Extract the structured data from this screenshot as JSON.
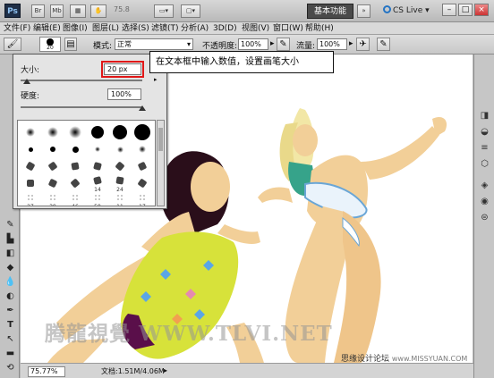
{
  "app": {
    "logo": "Ps",
    "bridge_label": "Br",
    "minibridge_label": "Mb",
    "zoom_readout": "75.8",
    "workspace_label": "基本功能",
    "cslive_label": "CS Live"
  },
  "menu": [
    "文件(F)",
    "编辑(E)",
    "图像(I)",
    "图层(L)",
    "选择(S)",
    "滤镜(T)",
    "分析(A)",
    "3D(D)",
    "视图(V)",
    "窗口(W)",
    "帮助(H)"
  ],
  "options": {
    "brush_size": "20",
    "mode_label": "模式:",
    "mode_value": "正常",
    "opacity_label": "不透明度:",
    "opacity_value": "100%",
    "flow_label": "流量:",
    "flow_value": "100%"
  },
  "brush_picker": {
    "size_label": "大小:",
    "size_value": "20 px",
    "size_slider_fraction": 0.05,
    "hardness_label": "硬度:",
    "hardness_value": "100%",
    "hardness_slider_fraction": 1.0,
    "presets": [
      {
        "kind": "soft",
        "num": ""
      },
      {
        "kind": "soft",
        "num": ""
      },
      {
        "kind": "soft",
        "num": ""
      },
      {
        "kind": "hard",
        "num": ""
      },
      {
        "kind": "hard",
        "num": ""
      },
      {
        "kind": "hard",
        "num": ""
      },
      {
        "kind": "hard-s",
        "num": ""
      },
      {
        "kind": "hard-s",
        "num": ""
      },
      {
        "kind": "hard-s",
        "num": ""
      },
      {
        "kind": "soft-s",
        "num": ""
      },
      {
        "kind": "soft-s",
        "num": ""
      },
      {
        "kind": "soft-s",
        "num": ""
      },
      {
        "kind": "tip",
        "num": ""
      },
      {
        "kind": "tip",
        "num": ""
      },
      {
        "kind": "tip",
        "num": ""
      },
      {
        "kind": "tip",
        "num": ""
      },
      {
        "kind": "tip",
        "num": ""
      },
      {
        "kind": "tip",
        "num": ""
      },
      {
        "kind": "tip",
        "num": ""
      },
      {
        "kind": "tip",
        "num": ""
      },
      {
        "kind": "tip",
        "num": ""
      },
      {
        "kind": "tip",
        "num": "14"
      },
      {
        "kind": "tip",
        "num": "24"
      },
      {
        "kind": "tip",
        "num": ""
      },
      {
        "kind": "scatter",
        "num": "27"
      },
      {
        "kind": "scatter",
        "num": "39"
      },
      {
        "kind": "scatter",
        "num": "46"
      },
      {
        "kind": "scatter",
        "num": "59"
      },
      {
        "kind": "scatter",
        "num": "11"
      },
      {
        "kind": "scatter",
        "num": "17"
      }
    ]
  },
  "callout": "在文本框中输入数值，设置画笔大小",
  "status": {
    "zoom": "75.77%",
    "doc_info": "文档:1.51M/4.06M"
  },
  "watermark": "腾龍視覺 WWW.TLVI.NET",
  "credit_main": "思缘设计论坛",
  "credit_site": "www.MISSYUAN.COM",
  "colors": {
    "workspace_button": "#4a4a4a",
    "callout_border": "#111111",
    "highlight": "#e01818",
    "dress_yellow": "#d7e23a",
    "skin": "#f2cf98"
  }
}
